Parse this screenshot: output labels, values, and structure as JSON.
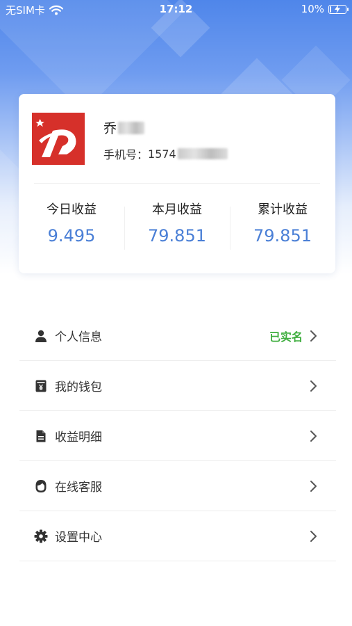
{
  "status_bar": {
    "carrier": "无SIM卡",
    "time": "17:12",
    "battery": "10%",
    "battery_level": 0.1,
    "icons": [
      "wifi-icon",
      "battery-charging-icon"
    ]
  },
  "profile": {
    "name_visible": "乔",
    "phone_label": "手机号：",
    "phone_visible": "1574"
  },
  "stats": [
    {
      "label": "今日收益",
      "value": "9.495"
    },
    {
      "label": "本月收益",
      "value": "79.851"
    },
    {
      "label": "累计收益",
      "value": "79.851"
    }
  ],
  "menu": [
    {
      "label": "个人信息",
      "icon": "person-icon",
      "status": "已实名"
    },
    {
      "label": "我的钱包",
      "icon": "wallet-icon",
      "status": ""
    },
    {
      "label": "收益明细",
      "icon": "document-icon",
      "status": ""
    },
    {
      "label": "在线客服",
      "icon": "customer-service-icon",
      "status": ""
    },
    {
      "label": "设置中心",
      "icon": "gear-icon",
      "status": ""
    }
  ],
  "colors": {
    "accent": "#4a7fd6",
    "verified": "#3fae3f",
    "logo_red": "#d6302a"
  }
}
